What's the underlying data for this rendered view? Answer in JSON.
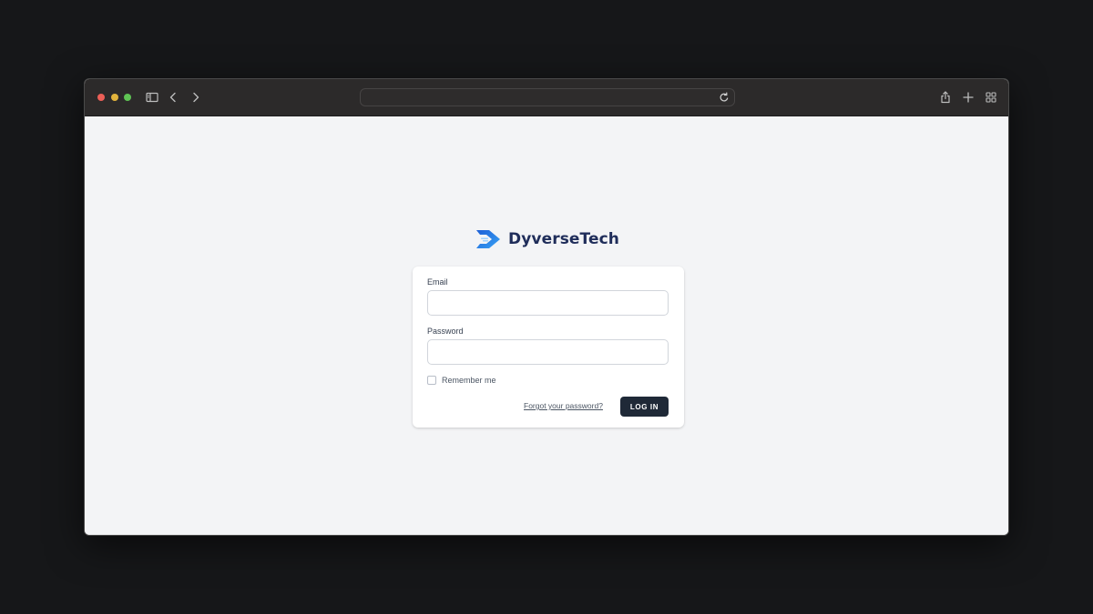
{
  "browser": {
    "address_text": "",
    "icons": {
      "sidebar": "sidebar-icon",
      "back": "back-icon",
      "forward": "forward-icon",
      "reload": "reload-icon",
      "share": "share-icon",
      "new_tab": "plus-icon",
      "tabs_overview": "grid-icon"
    }
  },
  "brand": {
    "name": "DyverseTech",
    "accent_color": "#2f8cf0",
    "text_color": "#1f2d5a"
  },
  "login": {
    "email_label": "Email",
    "email_value": "",
    "password_label": "Password",
    "password_value": "",
    "remember_label": "Remember me",
    "remember_checked": false,
    "forgot_label": "Forgot your password?",
    "submit_label": "LOG IN"
  }
}
